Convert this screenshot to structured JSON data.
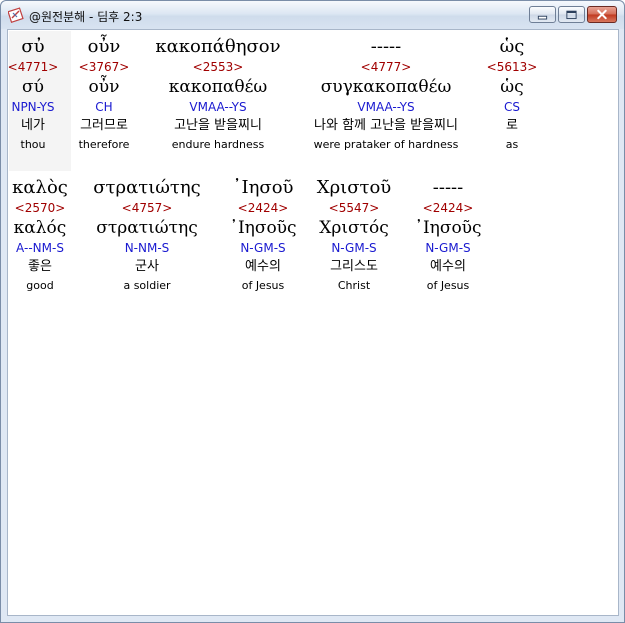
{
  "window": {
    "title": "@원전분해 - 딤후 2:3"
  },
  "icons": {
    "app": "app-logo-icon",
    "minimize": "minimize-icon",
    "maximize": "maximize-icon",
    "close": "close-icon"
  },
  "colors": {
    "strong": "#a00000",
    "parse": "#1a1ad0"
  },
  "words": [
    {
      "greek": "σὐ",
      "strong": "<4771>",
      "lemma": "σύ",
      "parse": "NPN-YS",
      "korean": "네가",
      "english": "thou"
    },
    {
      "greek": "οὖν",
      "strong": "<3767>",
      "lemma": "οὖν",
      "parse": "CH",
      "korean": "그러므로",
      "english": "therefore"
    },
    {
      "greek": "κακοπάθησον",
      "strong": "<2553>",
      "lemma": "κακοπαθέω",
      "parse": "VMAA--YS",
      "korean": "고난을 받을찌니",
      "english": "endure hardness"
    },
    {
      "greek": "-----",
      "strong": "<4777>",
      "lemma": "συγκακοπαθέω",
      "parse": "VMAA--YS",
      "korean": "나와 함께 고난을 받을찌니",
      "english": "were prataker of hardness"
    },
    {
      "greek": "ὡς",
      "strong": "<5613>",
      "lemma": "ὡς",
      "parse": "CS",
      "korean": "로",
      "english": "as"
    },
    {
      "greek": "καλὸς",
      "strong": "<2570>",
      "lemma": "καλός",
      "parse": "A--NM-S",
      "korean": "좋은",
      "english": "good"
    },
    {
      "greek": "στρατιώτης",
      "strong": "<4757>",
      "lemma": "στρατιώτης",
      "parse": "N-NM-S",
      "korean": "군사",
      "english": "a soldier"
    },
    {
      "greek": "᾿Ιησοῦ",
      "strong": "<2424>",
      "lemma": "᾿Ιησοῦς",
      "parse": "N-GM-S",
      "korean": "예수의",
      "english": "of Jesus"
    },
    {
      "greek": "Χριστοῦ",
      "strong": "<5547>",
      "lemma": "Χριστός",
      "parse": "N-GM-S",
      "korean": "그리스도",
      "english": "Christ"
    },
    {
      "greek": "-----",
      "strong": "<2424>",
      "lemma": "᾿Ιησοῦς",
      "parse": "N-GM-S",
      "korean": "예수의",
      "english": "of Jesus"
    }
  ]
}
